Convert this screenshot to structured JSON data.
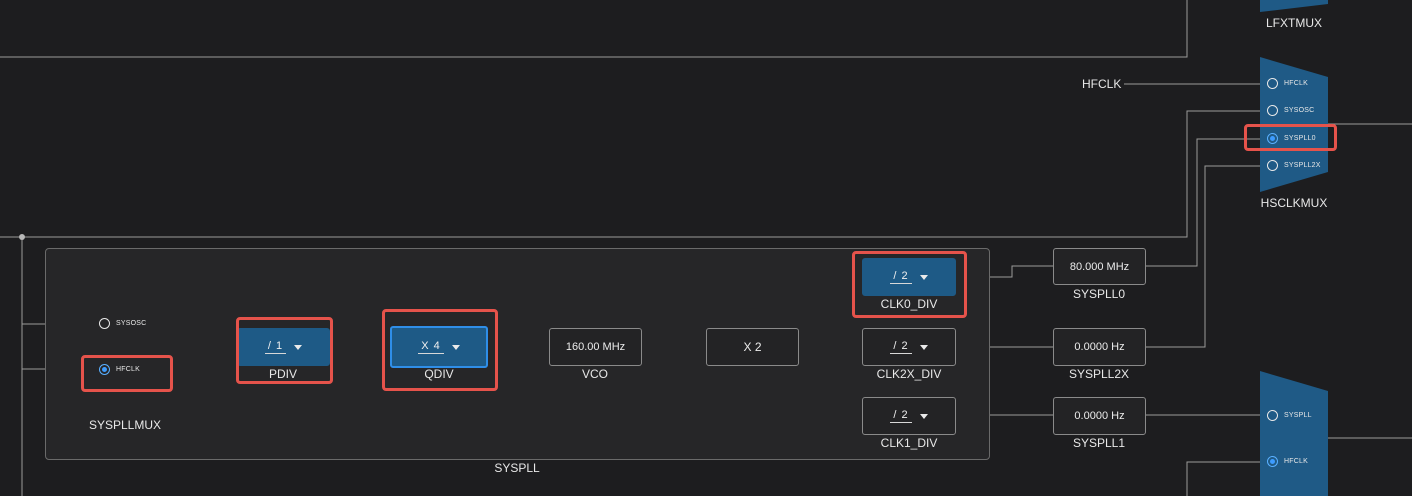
{
  "muxes": {
    "lfxtmux": {
      "label": "LFXTMUX"
    },
    "hsclkmux": {
      "label": "HSCLKMUX",
      "options": [
        "HFCLK",
        "SYSOSC",
        "SYSPLL0",
        "SYSPLL2X"
      ],
      "selected": "SYSPLL0"
    },
    "syspllmux": {
      "label": "SYSPLLMUX",
      "options": [
        "SYSOSC",
        "HFCLK"
      ],
      "selected": "HFCLK"
    },
    "bottom_mux": {
      "options": [
        "SYSPLL",
        "HFCLK"
      ],
      "selected": "HFCLK"
    }
  },
  "hfclk_input_label": "HFCLK",
  "syspll_group_label": "SYSPLL",
  "pdiv": {
    "label": "PDIV",
    "value": "/ 1"
  },
  "qdiv": {
    "label": "QDIV",
    "value": "X 4"
  },
  "vco": {
    "label": "VCO",
    "value": "160.00 MHz"
  },
  "x2": {
    "value": "X 2"
  },
  "clk0_div": {
    "label": "CLK0_DIV",
    "value": "/ 2"
  },
  "clk2x_div": {
    "label": "CLK2X_DIV",
    "value": "/ 2"
  },
  "clk1_div": {
    "label": "CLK1_DIV",
    "value": "/ 2"
  },
  "syspll0": {
    "label": "SYSPLL0",
    "value": "80.000 MHz"
  },
  "syspll2x": {
    "label": "SYSPLL2X",
    "value": "0.0000 Hz"
  },
  "syspll1": {
    "label": "SYSPLL1",
    "value": "0.0000 Hz"
  },
  "colors": {
    "background": "#1d1d1f",
    "wire": "#9a9a9a",
    "mux_fill": "#1f5a86",
    "divider_fill": "#1e5a86",
    "focus_border": "#2f8ee8",
    "highlight": "#e5534b",
    "radio_selected": "#3d9cff"
  }
}
